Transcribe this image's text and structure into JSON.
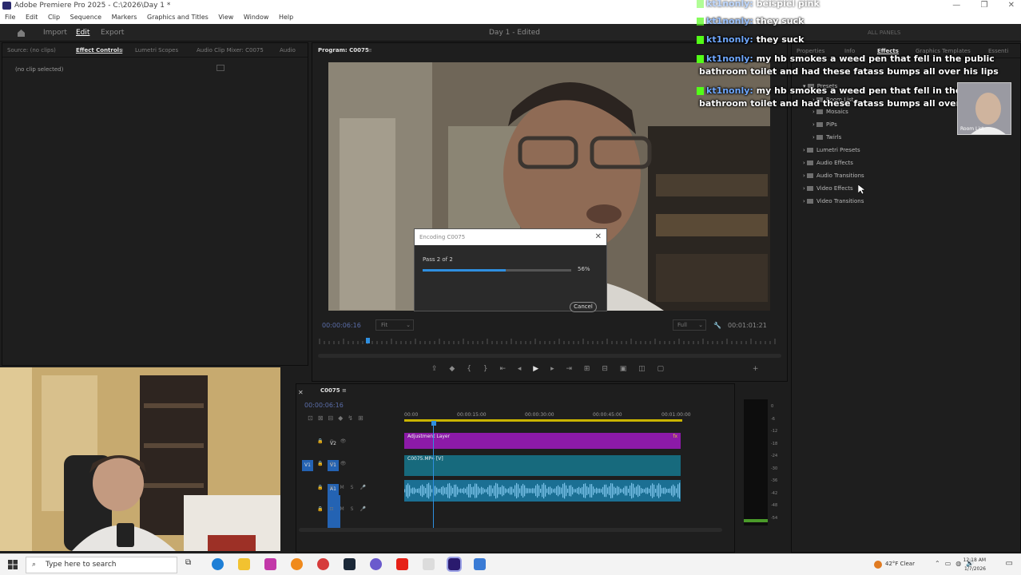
{
  "window": {
    "title": "Adobe Premiere Pro 2025 - C:\\2026\\Day 1 *",
    "controls": [
      "—",
      "❐",
      "✕"
    ]
  },
  "menu": [
    "File",
    "Edit",
    "Clip",
    "Sequence",
    "Markers",
    "Graphics and Titles",
    "View",
    "Window",
    "Help"
  ],
  "workspace": {
    "home_icon": "home-icon",
    "tabs": [
      "Import",
      "Edit",
      "Export"
    ],
    "active_tab": "Edit",
    "project_title": "Day 1 - Edited",
    "all_panels": "ALL PANELS"
  },
  "source_panel": {
    "tabs": [
      "Source: (no clips)",
      "Effect Controls",
      "Lumetri Scopes",
      "Audio Clip Mixer: C0075",
      "Audio"
    ],
    "active_tab": "Effect Controls",
    "empty_text": "(no clip selected)"
  },
  "program_monitor": {
    "title": "Program: C0075",
    "timecode_current": "00:00:06:16",
    "fit": "Fit",
    "quality": "Full",
    "timecode_duration": "00:01:01:21"
  },
  "export_dialog": {
    "title": "Encoding C0075",
    "pass_text": "Pass 2 of 2",
    "progress_percent": 56,
    "progress_label": "56%",
    "cancel_label": "Cancel"
  },
  "timeline": {
    "sequence_tab": "C0075",
    "timecode": "00:00:06:16",
    "ruler_labels": [
      "00:00",
      "00:00:15:00",
      "00:00:30:00",
      "00:00:45:00",
      "00:01:00:00"
    ],
    "tracks": {
      "video": [
        "V2",
        "V1"
      ],
      "audio": [
        "A1",
        "A2"
      ]
    },
    "clips": {
      "adjustment": "Adjustment Layer",
      "video": "C0075.MP4 [V]"
    }
  },
  "audio_meter": {
    "labels": [
      "0",
      "-6",
      "-12",
      "-18",
      "-24",
      "-30",
      "-36",
      "-42",
      "-48",
      "-54"
    ]
  },
  "effects_panel": {
    "tabs": [
      "Properties",
      "Info",
      "Effects",
      "Graphics Templates",
      "Essenti"
    ],
    "active_tab": "Effects",
    "tree": [
      "Presets",
      "Room List",
      "Mosaics",
      "PiPs",
      "Twirls",
      "Lumetri Presets",
      "Audio Effects",
      "Audio Transitions",
      "Video Effects",
      "Video Transitions"
    ]
  },
  "chat": {
    "messages": [
      {
        "user": "kt1nonly:",
        "text": "beispiel pink"
      },
      {
        "user": "kt1nonly:",
        "text": "they suck"
      },
      {
        "user": "kt1nonly:",
        "text": "they suck"
      },
      {
        "user": "kt1nonly:",
        "text": "my hb smokes a weed pen that fell in the public"
      },
      {
        "user": "",
        "text": "bathroom toilet and had these fatass bumps all over his lips"
      },
      {
        "user": "kt1nonly:",
        "text": "my hb smokes a weed pen that fell in the public"
      },
      {
        "user": "",
        "text": "bathroom toilet and had these fatass bumps all over his lips"
      }
    ],
    "thumb_label": "Room List"
  },
  "taskbar": {
    "search_placeholder": "Type here to search",
    "weather": "42°F Clear",
    "time": "12:18 AM",
    "date": "1/7/2026"
  },
  "colors": {
    "accent_blue": "#2f8fe0",
    "adjustment_clip": "#8c1aa8",
    "video_clip": "#176a7d",
    "audio_clip": "#1b6f93",
    "chat_badge": "#53fc18"
  }
}
